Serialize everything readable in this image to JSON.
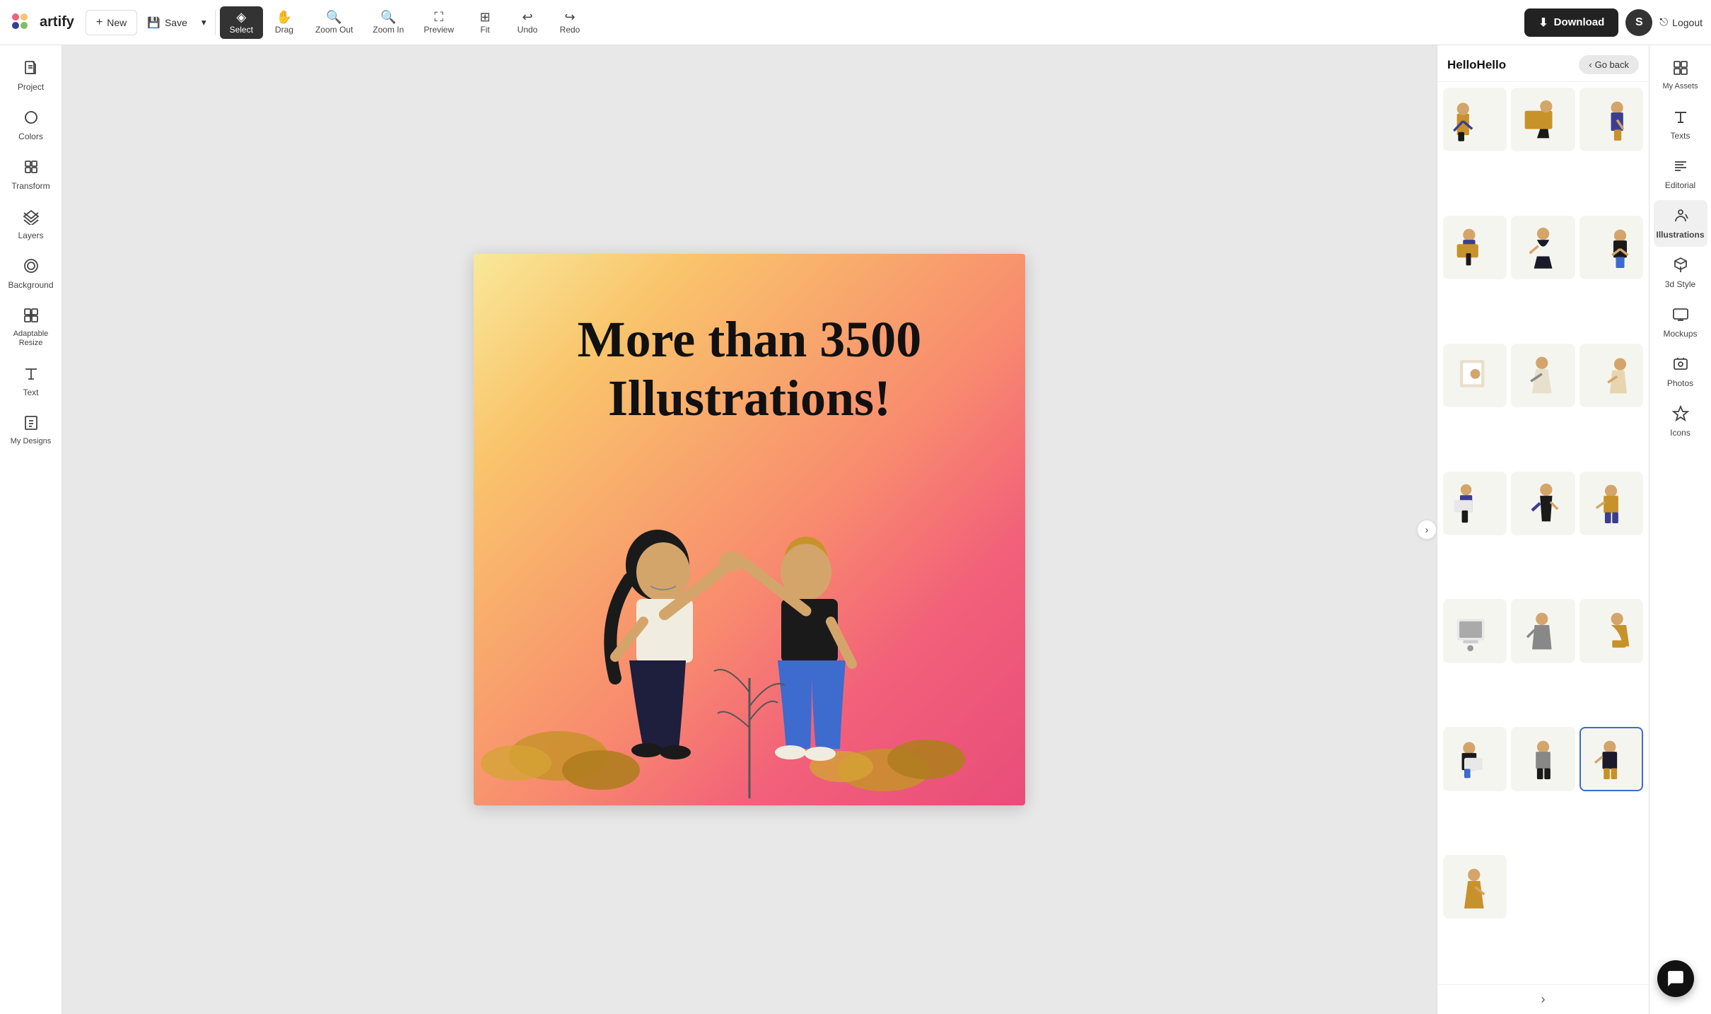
{
  "app": {
    "name": "artify"
  },
  "toolbar": {
    "new_label": "New",
    "save_label": "Save",
    "select_label": "Select",
    "drag_label": "Drag",
    "zoom_out_label": "Zoom Out",
    "zoom_in_label": "Zoom In",
    "preview_label": "Preview",
    "fit_label": "Fit",
    "undo_label": "Undo",
    "redo_label": "Redo",
    "download_label": "Download",
    "logout_label": "Logout",
    "user_initial": "S"
  },
  "left_sidebar": {
    "items": [
      {
        "id": "project",
        "label": "Project",
        "icon": "📄"
      },
      {
        "id": "colors",
        "label": "Colors",
        "icon": "🎨"
      },
      {
        "id": "transform",
        "label": "Transform",
        "icon": "⬛"
      },
      {
        "id": "layers",
        "label": "Layers",
        "icon": "🗂"
      },
      {
        "id": "background",
        "label": "Background",
        "icon": "⬜"
      },
      {
        "id": "adaptable-resize",
        "label": "Adaptable Resize",
        "icon": "⊞"
      },
      {
        "id": "text",
        "label": "Text",
        "icon": "📝"
      },
      {
        "id": "my-designs",
        "label": "My Designs",
        "icon": "📁"
      }
    ]
  },
  "canvas": {
    "headline_line1": "More than 3500",
    "headline_line2": "Illustrations!"
  },
  "right_panel": {
    "title": "HelloHello",
    "go_back_label": "Go back"
  },
  "far_right_sidebar": {
    "items": [
      {
        "id": "my-assets",
        "label": "My Assets",
        "icon": "🖼"
      },
      {
        "id": "texts",
        "label": "Texts",
        "icon": "T"
      },
      {
        "id": "editorial",
        "label": "Editorial",
        "icon": "☰"
      },
      {
        "id": "illustrations",
        "label": "Illustrations",
        "icon": "🚶"
      },
      {
        "id": "3d-style",
        "label": "3d Style",
        "icon": "⬡"
      },
      {
        "id": "mockups",
        "label": "Mockups",
        "icon": "💻"
      },
      {
        "id": "photos",
        "label": "Photos",
        "icon": "📷"
      },
      {
        "id": "icons",
        "label": "Icons",
        "icon": "🔷"
      }
    ]
  },
  "colors": {
    "primary": "#f2607a",
    "accent": "#3d3d8f",
    "gold": "#c8922a",
    "light": "#f9e89a"
  }
}
